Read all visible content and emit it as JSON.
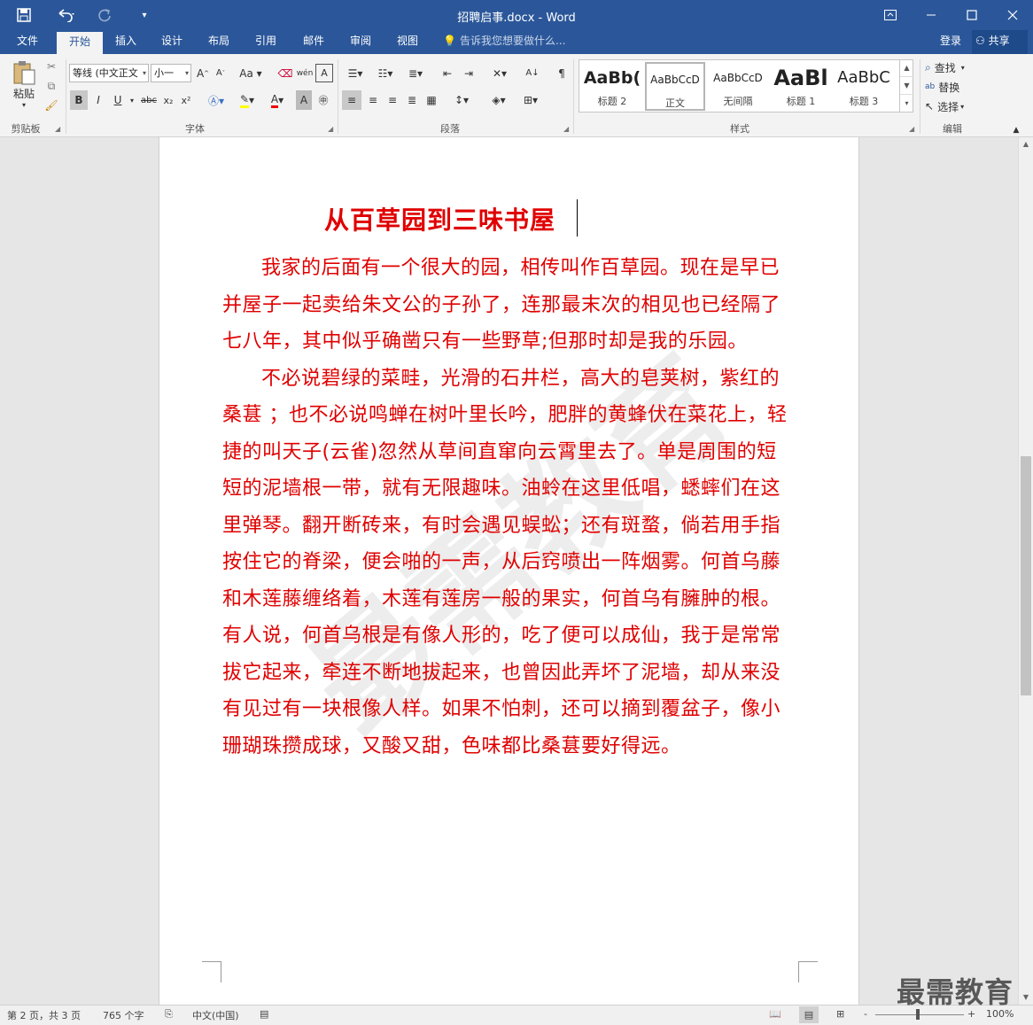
{
  "window": {
    "title": "招聘启事.docx - Word",
    "quick_access": {
      "save_icon": "save-icon",
      "undo_icon": "undo-icon",
      "redo_icon": "redo-icon",
      "customize_icon": "customize-icon"
    },
    "controls": {
      "ribbon_display": "ribbon-display-icon",
      "minimize": "minimize-icon",
      "maximize": "maximize-icon",
      "close": "close-icon"
    }
  },
  "tabs": [
    "文件",
    "开始",
    "插入",
    "设计",
    "布局",
    "引用",
    "邮件",
    "审阅",
    "视图"
  ],
  "active_tab": "开始",
  "tell_me": "告诉我您想要做什么...",
  "account": {
    "login": "登录",
    "share": "共享"
  },
  "ribbon": {
    "clipboard": {
      "paste": "粘贴",
      "label": "剪贴板"
    },
    "font": {
      "font_name": "等线 (中文正文",
      "font_size": "小一",
      "label": "字体",
      "buttons": [
        "B",
        "I",
        "U",
        "abc",
        "x₂",
        "x²"
      ]
    },
    "paragraph": {
      "label": "段落"
    },
    "styles": {
      "label": "样式",
      "items": [
        {
          "preview": "AaBb(",
          "name": "标题 2"
        },
        {
          "preview": "AaBbCcD",
          "name": "正文"
        },
        {
          "preview": "AaBbCcD",
          "name": "无间隔"
        },
        {
          "preview": "AaBl",
          "name": "标题 1"
        },
        {
          "preview": "AaBbC",
          "name": "标题 3"
        }
      ]
    },
    "editing": {
      "label": "编辑",
      "find": "查找",
      "replace": "替换",
      "select": "选择"
    }
  },
  "document": {
    "title": "从百草园到三味书屋",
    "paragraphs": [
      "我家的后面有一个很大的园，相传叫作百草园。现在是早已并屋子一起卖给朱文公的子孙了，连那最末次的相见也已经隔了七八年，其中似乎确凿只有一些野草;但那时却是我的乐园。",
      "不必说碧绿的菜畦，光滑的石井栏，高大的皂荚树，紫红的桑葚 ；也不必说鸣蝉在树叶里长吟，肥胖的黄蜂伏在菜花上，轻捷的叫天子(云雀)忽然从草间直窜向云霄里去了。单是周围的短短的泥墙根一带，就有无限趣味。油蛉在这里低唱，蟋蟀们在这里弹琴。翻开断砖来，有时会遇见蜈蚣；还有斑蝥，倘若用手指按住它的脊梁，便会啪的一声，从后窍喷出一阵烟雾。何首乌藤和木莲藤缠络着，木莲有莲房一般的果实，何首乌有臃肿的根。有人说，何首乌根是有像人形的，吃了便可以成仙，我于是常常拔它起来，牵连不断地拔起来，也曾因此弄坏了泥墙，却从来没有见过有一块根像人样。如果不怕刺，还可以摘到覆盆子，像小珊瑚珠攒成球，又酸又甜，色味都比桑葚要好得远。"
    ]
  },
  "status": {
    "page": "第 2 页，共 3 页",
    "words": "765 个字",
    "language": "中文(中国)",
    "zoom": "100%",
    "zoom_minus": "-",
    "zoom_plus": "+"
  },
  "brand_watermark": "最需教育",
  "colors": {
    "title_bar": "#2b579a",
    "doc_text": "#e00000"
  }
}
